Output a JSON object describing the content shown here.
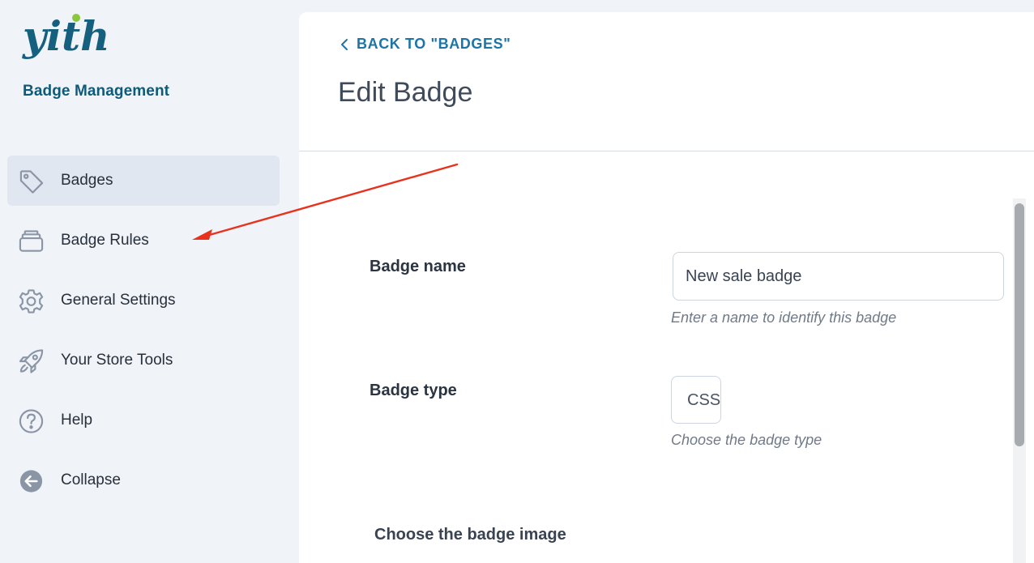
{
  "brand": {
    "logo_text": "yith",
    "subtitle": "Badge Management",
    "logo_color": "#15607f",
    "logo_dot_color": "#8cc63f"
  },
  "sidebar": {
    "items": [
      {
        "label": "Badges",
        "icon": "tag-icon",
        "active": true
      },
      {
        "label": "Badge Rules",
        "icon": "stack-icon",
        "active": false
      },
      {
        "label": "General Settings",
        "icon": "gear-icon",
        "active": false
      },
      {
        "label": "Your Store Tools",
        "icon": "rocket-icon",
        "active": false
      },
      {
        "label": "Help",
        "icon": "help-circle-icon",
        "active": false
      },
      {
        "label": "Collapse",
        "icon": "arrow-left-circle-icon",
        "active": false
      }
    ]
  },
  "header": {
    "back_label": "BACK TO \"BADGES\"",
    "title": "Edit Badge"
  },
  "form": {
    "badge_name": {
      "label": "Badge name",
      "value": "New sale badge",
      "help": "Enter a name to identify this badge"
    },
    "badge_type": {
      "label": "Badge type",
      "value": "CSS",
      "help": "Choose the badge type"
    },
    "badge_image": {
      "label": "Choose the badge image"
    }
  },
  "colors": {
    "accent": "#1d74a6",
    "annotation_arrow": "#e8321e",
    "sidebar_bg": "#f0f3f8",
    "active_bg": "#e1e7f0"
  }
}
